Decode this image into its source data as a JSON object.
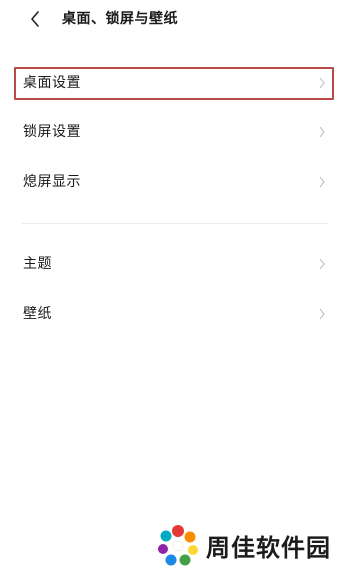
{
  "header": {
    "title": "桌面、锁屏与壁纸",
    "back_icon": "chevron-left-icon"
  },
  "section1": {
    "items": [
      {
        "label": "桌面设置",
        "icon": "chevron-right-icon",
        "highlighted": true
      },
      {
        "label": "锁屏设置",
        "icon": "chevron-right-icon"
      },
      {
        "label": "熄屏显示",
        "icon": "chevron-right-icon"
      }
    ]
  },
  "section2": {
    "items": [
      {
        "label": "主题",
        "icon": "chevron-right-icon"
      },
      {
        "label": "壁纸",
        "icon": "chevron-right-icon"
      }
    ]
  },
  "watermark": {
    "text": "周佳软件园",
    "logo": "pinwheel-logo"
  },
  "colors": {
    "highlight_border": "#b84a4a",
    "chevron": "#c4c4c4",
    "text": "#1a1a1a"
  }
}
